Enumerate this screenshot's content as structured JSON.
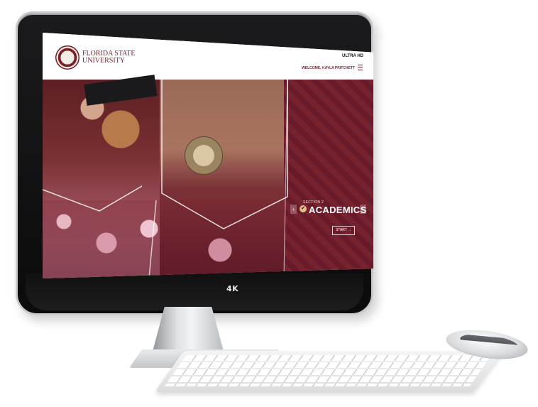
{
  "header": {
    "brand_line1": "FLORIDA STATE",
    "brand_line2": "UNIVERSITY",
    "ultrahd": "ULTRA HD",
    "welcome": "WELCOME, KAYLA PRITCHETT"
  },
  "hero": {
    "section_label": "SECTION 2",
    "title": "ACADEMICS",
    "start_label": "START",
    "start_arrow": "→",
    "prev_arrow": "‹",
    "next_arrow": "›",
    "check_glyph": "✔"
  },
  "toolbar_icons": [
    "check-icon",
    "pencil-icon",
    "star-icon",
    "help-icon",
    "search-icon"
  ],
  "toolbar_glyphs": "✔ ✎ ✦ ? ⌕",
  "monitor_badge": "4K",
  "colors": {
    "garnet": "#7a1f2b",
    "gold": "#e0c18a"
  }
}
